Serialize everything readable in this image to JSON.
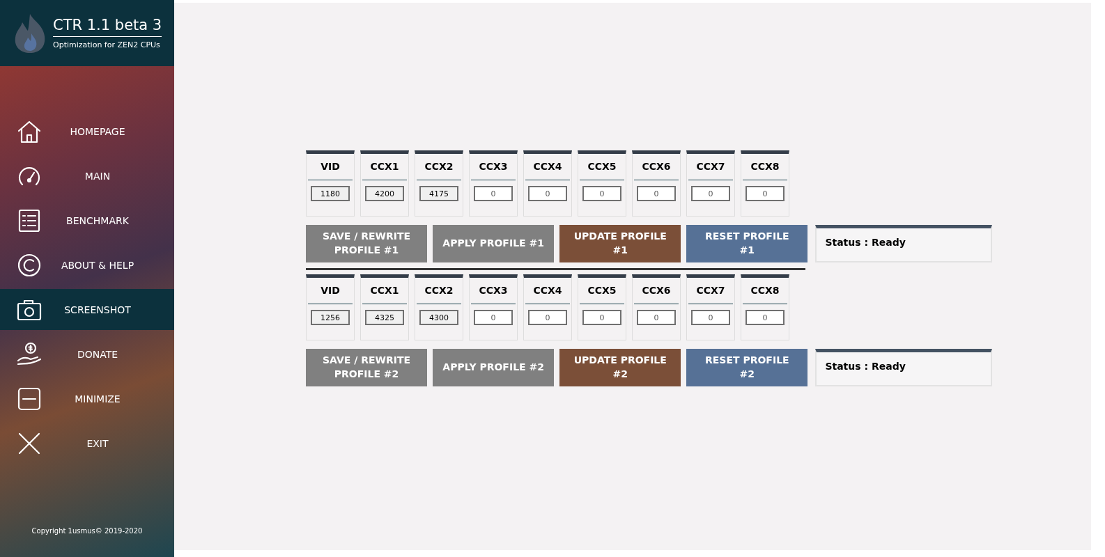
{
  "app": {
    "title": "CTR 1.1 beta 3",
    "subtitle": "Optimization for ZEN2 CPUs"
  },
  "sidebar": {
    "items": [
      {
        "label": "HOMEPAGE",
        "kind": "home",
        "selected": false
      },
      {
        "label": "MAIN",
        "kind": "gauge",
        "selected": false
      },
      {
        "label": "BENCHMARK",
        "kind": "list",
        "selected": false
      },
      {
        "label": "ABOUT & HELP",
        "kind": "copyright",
        "selected": false
      },
      {
        "label": "SCREENSHOT",
        "kind": "camera",
        "selected": true
      },
      {
        "label": "DONATE",
        "kind": "donate",
        "selected": false
      },
      {
        "label": "MINIMIZE",
        "kind": "minimize",
        "selected": false
      },
      {
        "label": "EXIT",
        "kind": "exit",
        "selected": false
      }
    ],
    "copyright": "Copyright 1usmus© 2019-2020"
  },
  "profiles": [
    {
      "fields": [
        {
          "label": "VID",
          "value": "1180",
          "modified": true
        },
        {
          "label": "CCX1",
          "value": "4200",
          "modified": true
        },
        {
          "label": "CCX2",
          "value": "4175",
          "modified": true
        },
        {
          "label": "CCX3",
          "value": "0",
          "modified": false
        },
        {
          "label": "CCX4",
          "value": "0",
          "modified": false
        },
        {
          "label": "CCX5",
          "value": "0",
          "modified": false
        },
        {
          "label": "CCX6",
          "value": "0",
          "modified": false
        },
        {
          "label": "CCX7",
          "value": "0",
          "modified": false
        },
        {
          "label": "CCX8",
          "value": "0",
          "modified": false
        }
      ],
      "buttons": [
        {
          "label": "SAVE / REWRITE PROFILE #1",
          "kind": "save"
        },
        {
          "label": "APPLY PROFILE #1",
          "kind": "apply"
        },
        {
          "label": "UPDATE PROFILE #1",
          "kind": "update"
        },
        {
          "label": "RESET PROFILE #1",
          "kind": "reset"
        }
      ],
      "status": "Status : Ready"
    },
    {
      "fields": [
        {
          "label": "VID",
          "value": "1256",
          "modified": true
        },
        {
          "label": "CCX1",
          "value": "4325",
          "modified": true
        },
        {
          "label": "CCX2",
          "value": "4300",
          "modified": true
        },
        {
          "label": "CCX3",
          "value": "0",
          "modified": false
        },
        {
          "label": "CCX4",
          "value": "0",
          "modified": false
        },
        {
          "label": "CCX5",
          "value": "0",
          "modified": false
        },
        {
          "label": "CCX6",
          "value": "0",
          "modified": false
        },
        {
          "label": "CCX7",
          "value": "0",
          "modified": false
        },
        {
          "label": "CCX8",
          "value": "0",
          "modified": false
        }
      ],
      "buttons": [
        {
          "label": "SAVE / REWRITE PROFILE #2",
          "kind": "save"
        },
        {
          "label": "APPLY PROFILE #2",
          "kind": "apply"
        },
        {
          "label": "UPDATE PROFILE #2",
          "kind": "update"
        },
        {
          "label": "RESET PROFILE #2",
          "kind": "reset"
        }
      ],
      "status": "Status : Ready"
    }
  ]
}
